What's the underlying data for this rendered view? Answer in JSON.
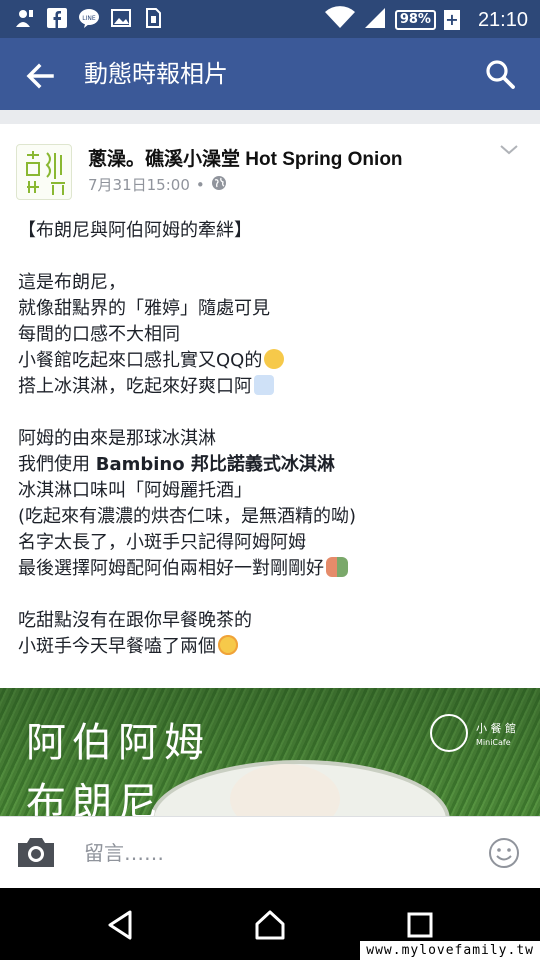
{
  "status_bar": {
    "battery": "98%",
    "time": "21:10"
  },
  "app_bar": {
    "title": "動態時報相片"
  },
  "post": {
    "page_name": "蔥澡。礁溪小澡堂 Hot Spring Onion",
    "timestamp": "7月31日15:00",
    "separator": "•",
    "lines": [
      "【布朗尼與阿伯阿姆的牽絆】",
      "",
      "這是布朗尼，",
      "就像甜點界的「雅婷」隨處可見",
      "每間的口感不大相同",
      "小餐館吃起來口感扎實又QQ的",
      "搭上冰淇淋，吃起來好爽口阿",
      "",
      "阿姆的由來是那球冰淇淋",
      "我們使用 ",
      "冰淇淋口味叫「阿姆麗托酒」",
      "(吃起來有濃濃的烘杏仁味，是無酒精的呦)",
      "名字太長了，小斑手只記得阿姆阿姆",
      "最後選擇阿姆配阿伯兩相好一對剛剛好",
      "",
      "吃甜點沒有在跟你早餐晚茶的",
      "小斑手今天早餐嗑了兩個"
    ],
    "bold_text": "Bambino 邦比諾義式冰淇淋",
    "photo": {
      "line1": "阿伯阿姆",
      "line2": "布朗尼",
      "brand_cn": "小 餐 館",
      "brand_en": "MiniCafe"
    }
  },
  "comment_bar": {
    "placeholder": "留言……"
  },
  "watermark": "www.mylovefamily.tw"
}
